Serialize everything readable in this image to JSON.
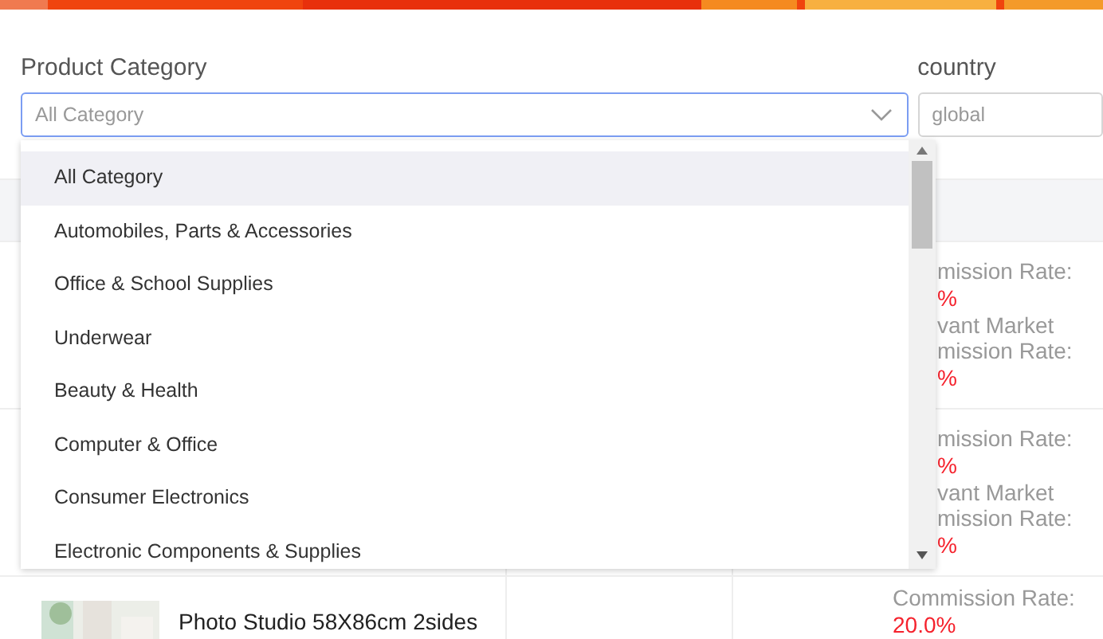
{
  "filters": [
    {
      "label": "Product Category",
      "placeholder": "All Category",
      "expanded": true
    },
    {
      "label": "country",
      "placeholder": "global",
      "expanded": false
    }
  ],
  "dropdown": {
    "options": [
      {
        "label": "All Category",
        "selected": true
      },
      {
        "label": "Automobiles, Parts & Accessories",
        "selected": false
      },
      {
        "label": "Office & School Supplies",
        "selected": false
      },
      {
        "label": "Underwear",
        "selected": false
      },
      {
        "label": "Beauty & Health",
        "selected": false
      },
      {
        "label": "Computer & Office",
        "selected": false
      },
      {
        "label": "Consumer Electronics",
        "selected": false
      },
      {
        "label": "Electronic Components & Supplies",
        "selected": false
      }
    ]
  },
  "table": {
    "rows": [
      {
        "rate_lines": [
          {
            "kind": "label",
            "text": "mission Rate:"
          },
          {
            "kind": "value",
            "text": "%"
          },
          {
            "kind": "label",
            "text": "vant Market"
          },
          {
            "kind": "label",
            "text": "mission Rate:"
          },
          {
            "kind": "value",
            "text": "%"
          }
        ]
      },
      {
        "rate_lines": [
          {
            "kind": "label",
            "text": "mission Rate:"
          },
          {
            "kind": "value",
            "text": "%"
          },
          {
            "kind": "label",
            "text": "vant Market"
          },
          {
            "kind": "label",
            "text": "mission Rate:"
          },
          {
            "kind": "value",
            "text": "%"
          }
        ]
      },
      {
        "product": {
          "name": "Photo Studio 58X86cm 2sides"
        },
        "rate_lines": [
          {
            "kind": "label",
            "text": "Commission Rate:"
          },
          {
            "kind": "value",
            "text": "20.0%"
          }
        ]
      }
    ]
  }
}
